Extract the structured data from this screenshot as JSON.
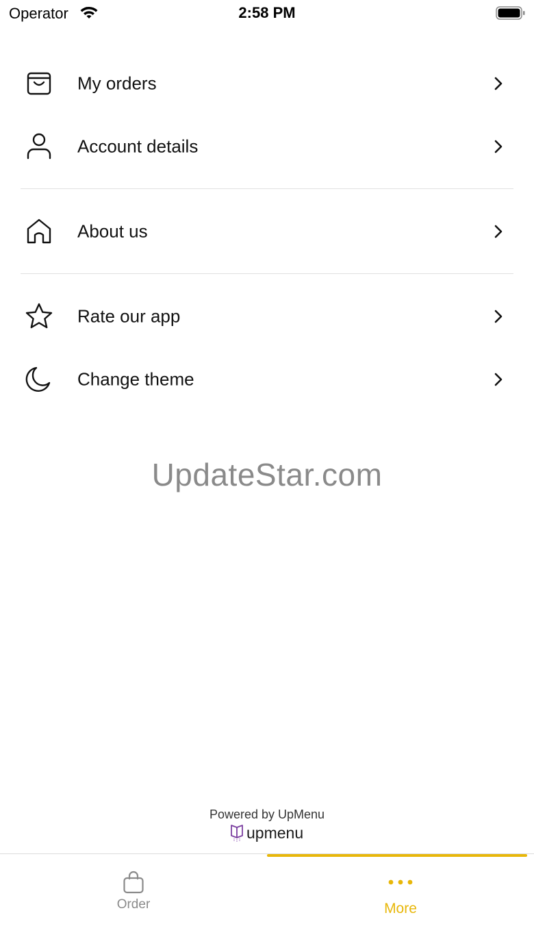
{
  "status_bar": {
    "carrier": "Operator",
    "time": "2:58 PM"
  },
  "menu": {
    "items": [
      {
        "label": "My orders",
        "icon": "shopping-bag-icon"
      },
      {
        "label": "Account details",
        "icon": "user-icon"
      },
      {
        "label": "About us",
        "icon": "home-icon"
      },
      {
        "label": "Rate our app",
        "icon": "star-icon"
      },
      {
        "label": "Change theme",
        "icon": "moon-icon"
      }
    ]
  },
  "watermark": "UpdateStar.com",
  "footer": {
    "powered_by": "Powered by UpMenu",
    "brand": "upmenu",
    "brand_color": "#7b3fa0"
  },
  "tabbar": {
    "tabs": [
      {
        "label": "Order",
        "icon": "shopping-bag-icon",
        "active": false
      },
      {
        "label": "More",
        "icon": "more-dots-icon",
        "active": true
      }
    ],
    "accent_color": "#e8b70a",
    "inactive_color": "#8a8a8a"
  }
}
